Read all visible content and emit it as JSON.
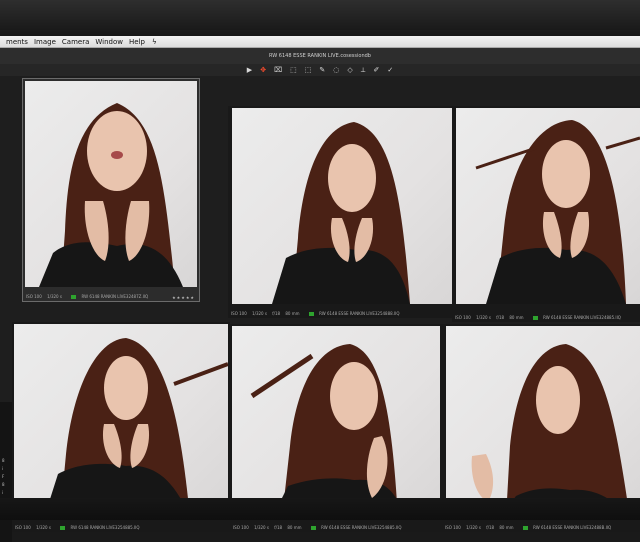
{
  "menubar": {
    "items": [
      "ments",
      "Image",
      "Camera",
      "Window",
      "Help"
    ],
    "glyph": "ϟ"
  },
  "titlebar": {
    "title": "RW 6148 ESSE RANKIN LIVE.cosessiondb"
  },
  "toolbar": {
    "tools": [
      "▶",
      "✥",
      "⌧",
      "⬚",
      "⬚",
      "✎",
      "◌",
      "◇",
      "⟂",
      "✐",
      "✓"
    ]
  },
  "left_strip": {
    "labels": [
      "8",
      "i",
      "F",
      "8",
      "i"
    ]
  },
  "thumbnails": [
    {
      "meta1": "ISO 100",
      "meta2": "1/320 s",
      "filename": "RW 6148 RANKIN LIVE32487Z.IIQ",
      "stars": "★★★★★",
      "selected": true
    },
    {
      "meta1": "ISO 100",
      "meta2": "1/320 s",
      "meta3": "f/18",
      "meta4": "80 mm",
      "filename": "RW 6148 ESSE RANKIN LIVE3254888.IIQ",
      "selected": false
    },
    {
      "meta1": "ISO 100",
      "meta2": "1/320 s",
      "meta3": "f/18",
      "meta4": "80 mm",
      "filename": "RW 6148 ESSE RANKIN LIVE324885.IIQ",
      "selected": false
    },
    {
      "meta1": "ISO 100",
      "meta2": "1/320 s",
      "filename": "RW 6148 RANKIN LIVE3254885.IIQ",
      "selected": false
    },
    {
      "meta1": "ISO 100",
      "meta2": "1/320 s",
      "meta3": "f/18",
      "meta4": "80 mm",
      "filename": "RW 6148 ESSE RANKIN LIVE3254885.IIQ",
      "selected": false
    },
    {
      "meta1": "ISO 100",
      "meta2": "1/320 s",
      "meta3": "f/18",
      "meta4": "80 mm",
      "filename": "RW 6148 ESSE RANKIN LIVE32488B.IIQ",
      "selected": false
    }
  ],
  "colors": {
    "accent": "#ff4d2e",
    "badge": "#2ea32e",
    "hair": "#4a2115",
    "jacket": "#161616",
    "skin": "#e9c4ae"
  }
}
